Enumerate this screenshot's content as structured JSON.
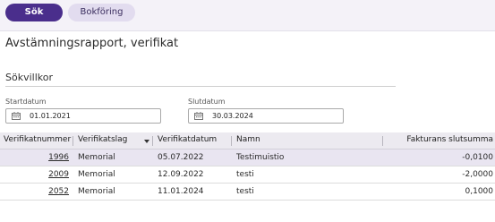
{
  "tabs": [
    {
      "label": "Sök",
      "active": true
    },
    {
      "label": "Bokföring",
      "active": false
    }
  ],
  "page_title": "Avstämningsrapport, verifikat",
  "search": {
    "section_title": "Sökvillkor",
    "start": {
      "label": "Startdatum",
      "value": "01.01.2021"
    },
    "end": {
      "label": "Slutdatum",
      "value": "30.03.2024"
    }
  },
  "table": {
    "columns": [
      "Verifikatnummer",
      "Verifikatslag",
      "Verifikatdatum",
      "Namn",
      "Fakturans slutsumma"
    ],
    "rows": [
      {
        "nummer": "1996",
        "slag": "Memorial",
        "datum": "05.07.2022",
        "namn": "Testimuistio",
        "summa": "-0,0100"
      },
      {
        "nummer": "2009",
        "slag": "Memorial",
        "datum": "12.09.2022",
        "namn": "testi",
        "summa": "-2,0000"
      },
      {
        "nummer": "2052",
        "slag": "Memorial",
        "datum": "11.01.2024",
        "namn": "testi",
        "summa": "0,1000"
      }
    ]
  },
  "colors": {
    "accent": "#4a2e8c",
    "accent_light": "#e2dcef",
    "selected_row": "#e9e5f1"
  },
  "icons": {
    "date_picker": "calendar-icon",
    "sort": "sort-desc-icon"
  }
}
